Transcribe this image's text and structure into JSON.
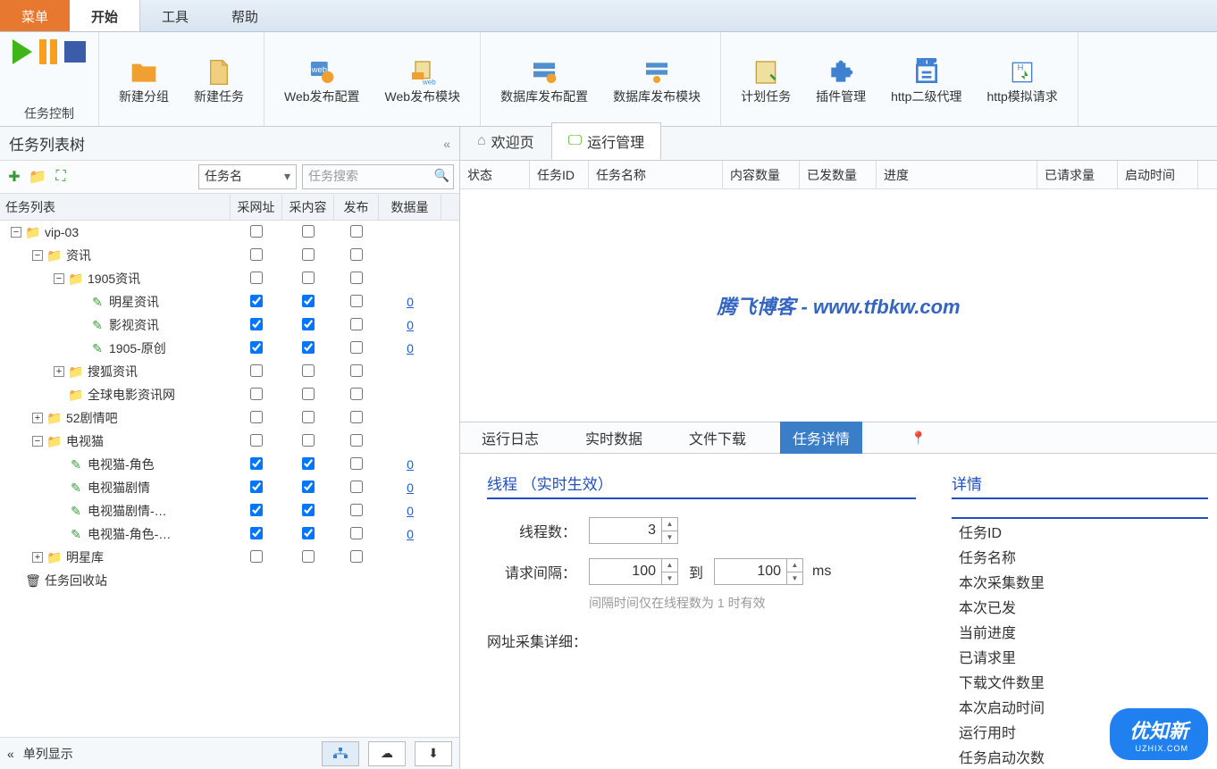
{
  "menu": {
    "main": "菜单",
    "tabs": [
      "开始",
      "工具",
      "帮助"
    ],
    "active": 0
  },
  "ribbon": {
    "task_control_label": "任务控制",
    "groups": [
      {
        "items": [
          {
            "label": "新建分组"
          },
          {
            "label": "新建任务"
          }
        ]
      },
      {
        "items": [
          {
            "label": "Web发布配置"
          },
          {
            "label": "Web发布模块"
          }
        ]
      },
      {
        "items": [
          {
            "label": "数据库发布配置"
          },
          {
            "label": "数据库发布模块"
          }
        ]
      },
      {
        "items": [
          {
            "label": "计划任务"
          },
          {
            "label": "插件管理"
          },
          {
            "label": "http二级代理"
          },
          {
            "label": "http模拟请求"
          }
        ]
      }
    ]
  },
  "left": {
    "title": "任务列表树",
    "filter_field": "任务名",
    "search_placeholder": "任务搜索",
    "columns": {
      "name": "任务列表",
      "url": "采网址",
      "content": "采内容",
      "publish": "发布",
      "data": "数据量"
    },
    "tree": [
      {
        "indent": 0,
        "exp": "-",
        "icon": "folder",
        "label": "vip-03",
        "url": false,
        "content": false,
        "pub": false,
        "data": null
      },
      {
        "indent": 1,
        "exp": "-",
        "icon": "folder",
        "label": "资讯",
        "url": false,
        "content": false,
        "pub": false,
        "data": null
      },
      {
        "indent": 2,
        "exp": "-",
        "icon": "folder",
        "label": "1905资讯",
        "url": false,
        "content": false,
        "pub": false,
        "data": null
      },
      {
        "indent": 3,
        "exp": "",
        "icon": "task",
        "label": "明星资讯",
        "url": true,
        "content": true,
        "pub": false,
        "data": "0"
      },
      {
        "indent": 3,
        "exp": "",
        "icon": "task",
        "label": "影视资讯",
        "url": true,
        "content": true,
        "pub": false,
        "data": "0"
      },
      {
        "indent": 3,
        "exp": "",
        "icon": "task",
        "label": "1905-原创",
        "url": true,
        "content": true,
        "pub": false,
        "data": "0"
      },
      {
        "indent": 2,
        "exp": "+",
        "icon": "folder",
        "label": "搜狐资讯",
        "url": false,
        "content": false,
        "pub": false,
        "data": null
      },
      {
        "indent": 2,
        "exp": "",
        "icon": "folder",
        "label": "全球电影资讯网",
        "url": false,
        "content": false,
        "pub": false,
        "data": null
      },
      {
        "indent": 1,
        "exp": "+",
        "icon": "folder",
        "label": "52剧情吧",
        "url": false,
        "content": false,
        "pub": false,
        "data": null
      },
      {
        "indent": 1,
        "exp": "-",
        "icon": "folder",
        "label": "电视猫",
        "url": false,
        "content": false,
        "pub": false,
        "data": null
      },
      {
        "indent": 2,
        "exp": "",
        "icon": "task",
        "label": "电视猫-角色",
        "url": true,
        "content": true,
        "pub": false,
        "data": "0"
      },
      {
        "indent": 2,
        "exp": "",
        "icon": "task",
        "label": "电视猫剧情",
        "url": true,
        "content": true,
        "pub": false,
        "data": "0"
      },
      {
        "indent": 2,
        "exp": "",
        "icon": "task",
        "label": "电视猫剧情-…",
        "url": true,
        "content": true,
        "pub": false,
        "data": "0"
      },
      {
        "indent": 2,
        "exp": "",
        "icon": "task",
        "label": "电视猫-角色-…",
        "url": true,
        "content": true,
        "pub": false,
        "data": "0"
      },
      {
        "indent": 1,
        "exp": "+",
        "icon": "folder",
        "label": "明星库",
        "url": false,
        "content": false,
        "pub": false,
        "data": null
      },
      {
        "indent": 0,
        "exp": "",
        "icon": "trash",
        "label": "任务回收站",
        "url": null,
        "content": null,
        "pub": null,
        "data": null
      }
    ],
    "footer_label": "单列显示"
  },
  "right": {
    "top_tabs": [
      {
        "label": "欢迎页"
      },
      {
        "label": "运行管理"
      }
    ],
    "active_top_tab": 1,
    "run_columns": [
      "状态",
      "任务ID",
      "任务名称",
      "内容数量",
      "已发数量",
      "进度",
      "已请求量",
      "启动时间"
    ],
    "run_column_widths": [
      78,
      66,
      150,
      86,
      86,
      180,
      90,
      90
    ],
    "watermark": "腾飞博客 - www.tfbkw.com",
    "detail_tabs": [
      "运行日志",
      "实时数据",
      "文件下载",
      "任务详情"
    ],
    "active_detail_tab": 3,
    "thread": {
      "title": "线程 （实时生效）",
      "count_label": "线程数：",
      "count_value": "3",
      "interval_label": "请求间隔：",
      "interval_from": "100",
      "interval_to": "100",
      "to_label": "到",
      "unit": "ms",
      "hint": "间隔时间仅在线程数为 1 时有效",
      "url_detail_label": "网址采集详细："
    },
    "info": {
      "title": "详情",
      "items": [
        "任务ID",
        "任务名称",
        "本次采集数里",
        "本次已发",
        "当前进度",
        "已请求里",
        "下载文件数里",
        "本次启动时间",
        "运行用时",
        "任务启动次数"
      ]
    }
  },
  "brand": {
    "name": "优知新",
    "sub": "UZHIX.COM"
  }
}
